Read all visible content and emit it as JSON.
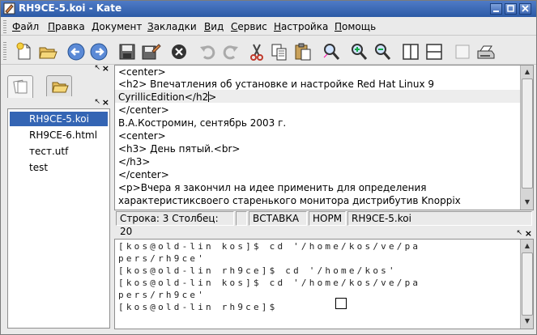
{
  "window": {
    "title": "RH9CE-5.koi - Kate"
  },
  "menu": [
    {
      "label": "Файл",
      "u": "Ф",
      "rest": "айл"
    },
    {
      "label": "Правка",
      "u": "П",
      "rest": "равка"
    },
    {
      "label": "Документ",
      "u": "Д",
      "rest": "окумент"
    },
    {
      "label": "Закладки",
      "u": "З",
      "rest": "акладки"
    },
    {
      "label": "Вид",
      "u": "В",
      "rest": "ид"
    },
    {
      "label": "Сервис",
      "u": "С",
      "rest": "ервис"
    },
    {
      "label": "Настройка",
      "u": "Н",
      "rest": "астройка"
    },
    {
      "label": "Помощь",
      "u": "П",
      "rest": "омощь"
    }
  ],
  "toolbar": {
    "icons": [
      "new-document-icon",
      "open-folder-icon",
      "back-arrow-icon",
      "forward-arrow-icon",
      "save-icon",
      "save-as-icon",
      "close-document-icon",
      "undo-icon",
      "redo-icon",
      "cut-icon",
      "copy-icon",
      "paste-icon",
      "find-icon",
      "zoom-in-icon",
      "zoom-out-icon",
      "split-vertical-icon",
      "split-horizontal-icon",
      "blank-icon",
      "print-icon"
    ]
  },
  "files": [
    {
      "name": "RH9CE-5.koi",
      "selected": true
    },
    {
      "name": "RH9CE-6.html",
      "selected": false
    },
    {
      "name": "тест.utf",
      "selected": false
    },
    {
      "name": "test",
      "selected": false
    }
  ],
  "editor": {
    "lines": [
      "<center>",
      "<h2> Впечатления об установке и настройке Red Hat Linux 9",
      "CyrillicEdition</h2>",
      "</center>",
      "В.А.Костромин, сентябрь 2003 г.",
      "<center>",
      "<h3> День пятый.<br>",
      "</h3>",
      "</center>",
      "<p>Вчера я закончил на идее применить для определения",
      "характеристиксвоего старенького монитора дистрибутив Knoppix"
    ]
  },
  "status": {
    "position": "Строка: 3 Столбец: 20",
    "mode": "ВСТАВКА",
    "encoding": "НОРМ",
    "filename": "RH9CE-5.koi"
  },
  "terminal": {
    "lines": [
      "[kos@old-lin kos]$ cd '/home/kos/ve/pa",
      "pers/rh9ce'",
      "[kos@old-lin rh9ce]$ cd '/home/kos'",
      "[kos@old-lin kos]$ cd '/home/kos/ve/pa",
      "pers/rh9ce'",
      "[kos@old-lin rh9ce]$ "
    ]
  },
  "colors": {
    "titlebar": "#2c5aa6",
    "selection": "#3465b4"
  }
}
